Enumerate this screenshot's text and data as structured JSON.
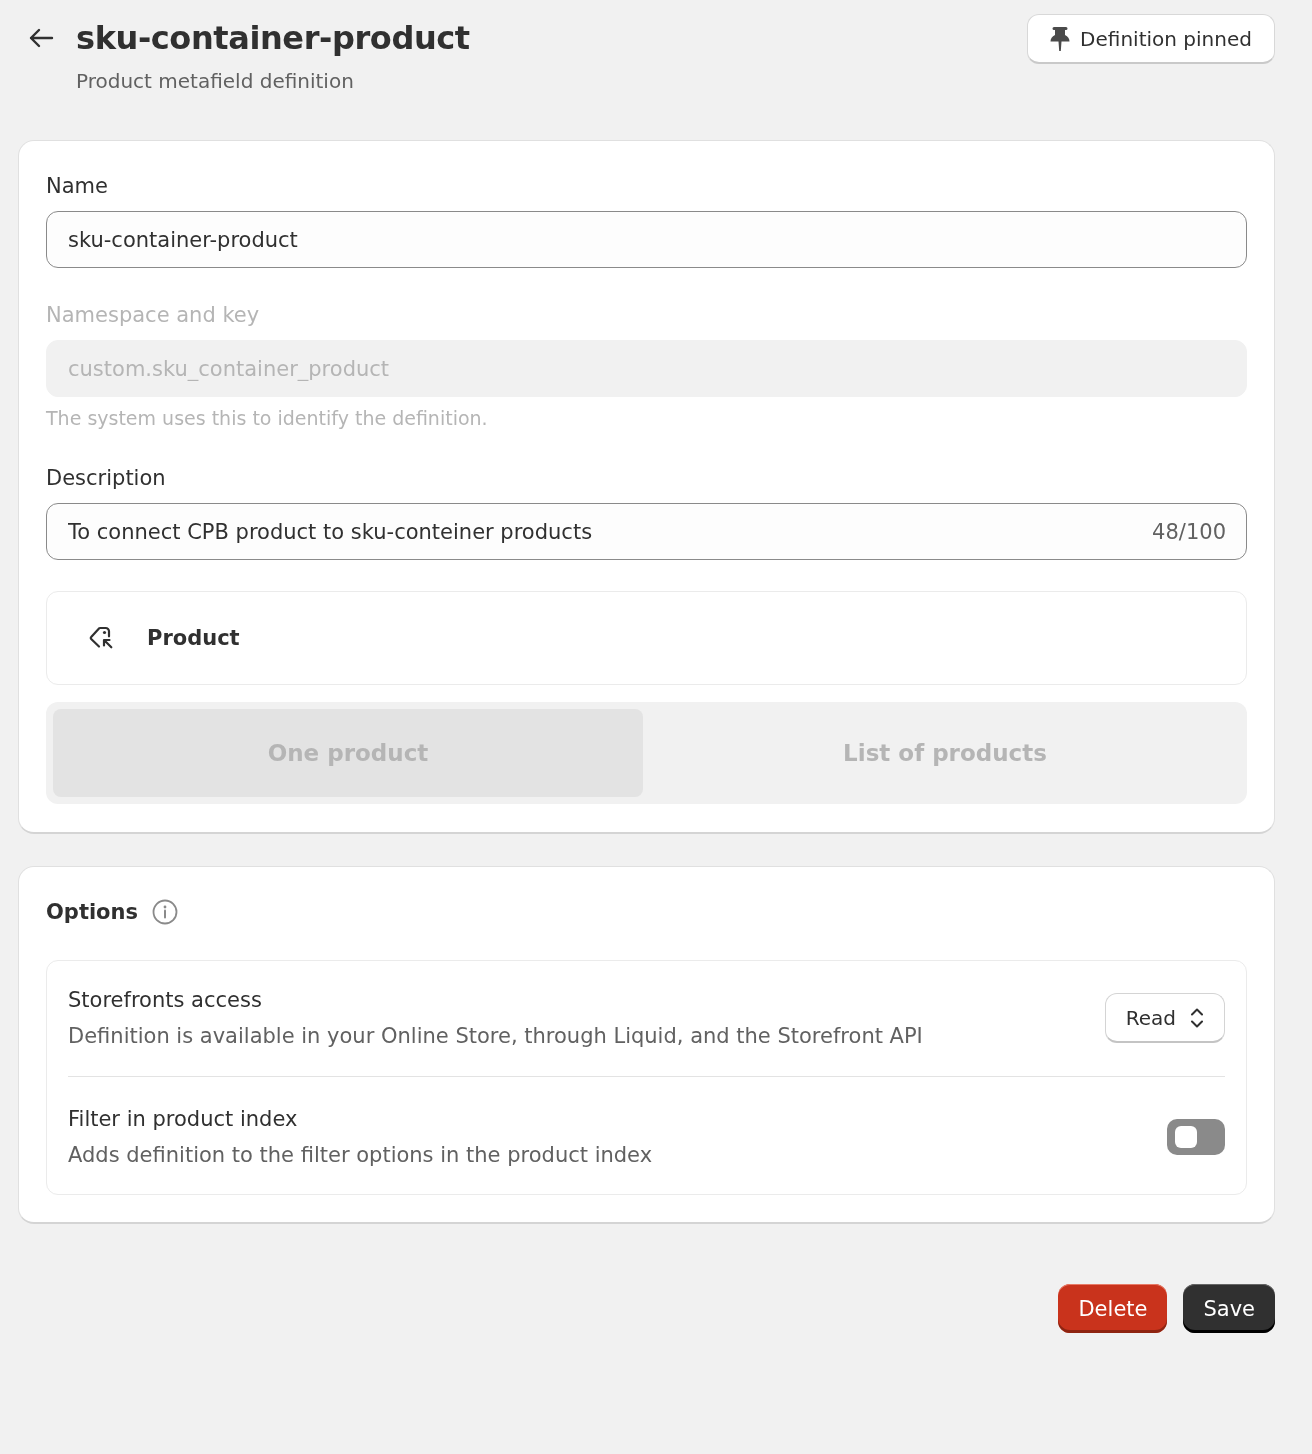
{
  "header": {
    "title": "sku-container-product",
    "subtitle": "Product metafield definition",
    "pin_button": {
      "label": "Definition pinned"
    }
  },
  "definition_card": {
    "name_field": {
      "label": "Name",
      "value": "sku-container-product"
    },
    "namespace_field": {
      "label": "Namespace and key",
      "value": "custom.sku_container_product",
      "help": "The system uses this to identify the definition.",
      "disabled": true
    },
    "description_field": {
      "label": "Description",
      "value": "To connect CPB product to sku-conteiner products",
      "counter": "48/100"
    },
    "type": {
      "label": "Product"
    },
    "cardinality": {
      "disabled": true,
      "options": [
        {
          "label": "One product",
          "selected": true
        },
        {
          "label": "List of products",
          "selected": false
        }
      ]
    }
  },
  "options_card": {
    "title": "Options",
    "rows": [
      {
        "kind": "select",
        "title": "Storefronts access",
        "description": "Definition is available in your Online Store, through Liquid, and the Storefront API",
        "value": "Read"
      },
      {
        "kind": "toggle",
        "title": "Filter in product index",
        "description": "Adds definition to the filter options in the product index",
        "on": false
      }
    ]
  },
  "actions": [
    {
      "kind": "destructive",
      "label": "Delete"
    },
    {
      "kind": "primary",
      "label": "Save"
    }
  ]
}
